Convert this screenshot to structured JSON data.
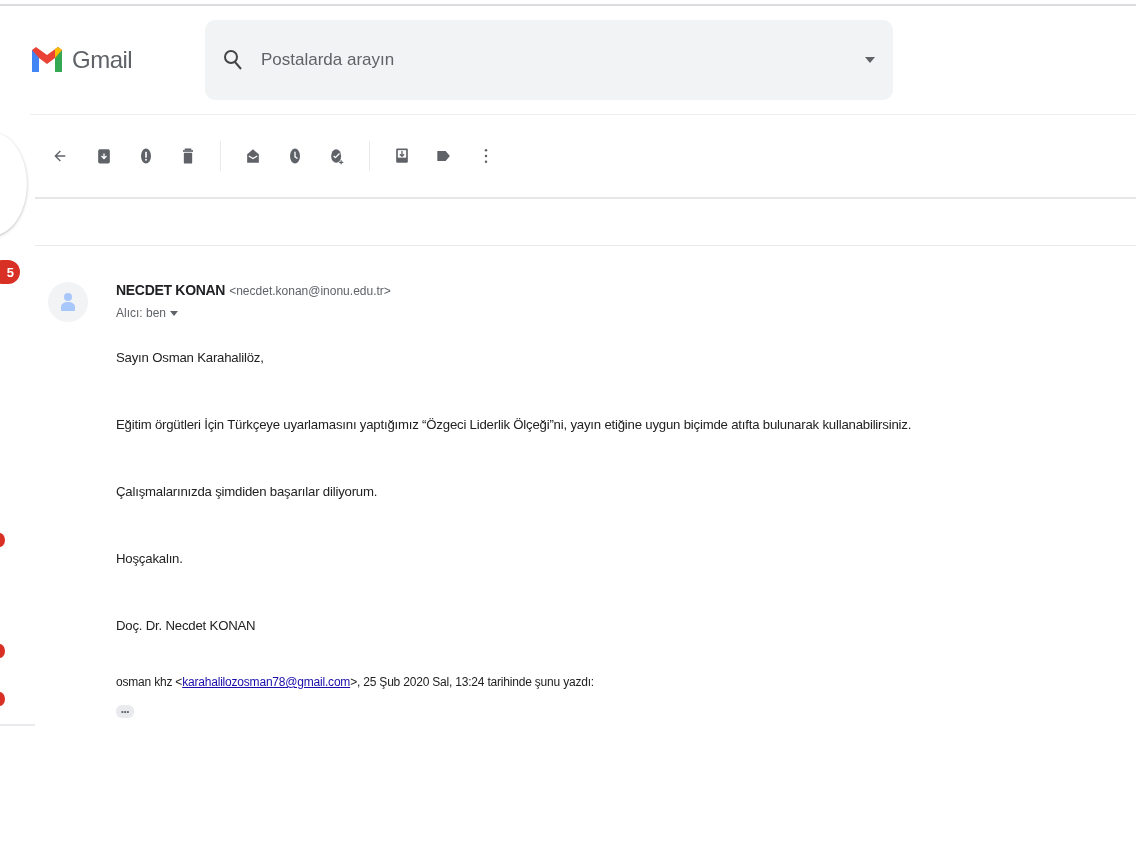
{
  "header": {
    "app_name": "Gmail",
    "search": {
      "placeholder": "Postalarda arayın"
    }
  },
  "sidebar": {
    "badge": "5"
  },
  "message": {
    "sender_name": "NECDET KONAN",
    "sender_email": "<necdet.konan@inonu.edu.tr>",
    "recipient": "Alıcı: ben",
    "body": [
      "Sayın Osman Karahalilöz,",
      "Eğitim örgütleri İçin Türkçeye uyarlamasını yaptığımız “Özgeci Liderlik Ölçeği”ni, yayın etiğine uygun biçimde atıfta bulunarak kullanabilirsiniz.",
      "Çalışmalarınızda şimdiden başarılar diliyorum.",
      "Hoşçakalın.",
      "Doç. Dr. Necdet KONAN"
    ],
    "quote_header": {
      "before": "osman khz <",
      "link": "karahalilozosman78@gmail.com",
      "after": ">, 25 Şub 2020 Sal, 13:24 tarihinde şunu yazdı:"
    },
    "show_trimmed": "•••"
  }
}
